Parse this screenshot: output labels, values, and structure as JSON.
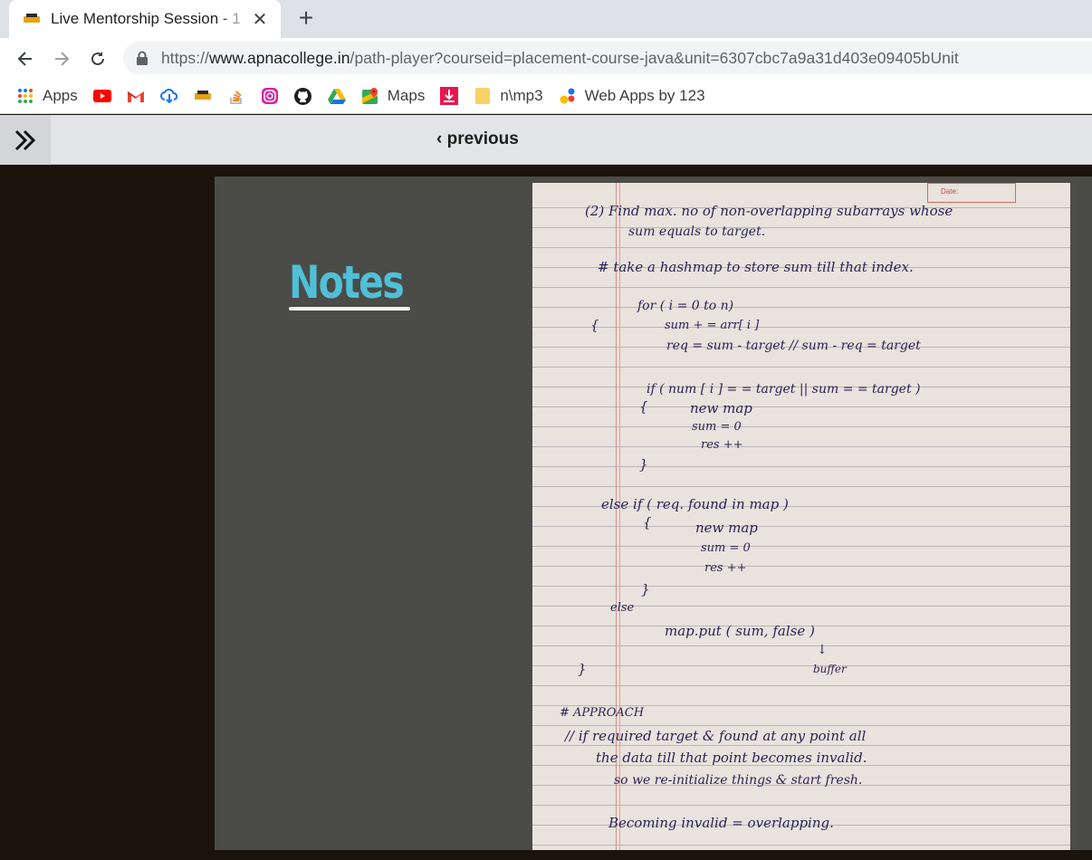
{
  "browser": {
    "tab_title": "Live Mentorship Session - 1",
    "close_glyph": "✕",
    "new_tab_glyph": "+",
    "url_scheme": "https://",
    "url_host": "www.apnacollege.in",
    "url_path": "/path-player?courseid=placement-course-java&unit=6307cbc7a9a31d403e09405bUnit",
    "bookmarks": {
      "apps": "Apps",
      "maps": "Maps",
      "mp3": "n\\mp3",
      "webapps": "Web Apps by 123"
    }
  },
  "player": {
    "previous_label": "‹ previous"
  },
  "slide": {
    "notes_title": "Notes",
    "paper": {
      "date_label": "Date:",
      "lines": {
        "l1": "(2)  Find max. no of non-overlapping subarrays whose",
        "l2": "sum equals to target.",
        "l3": "#  take a hashmap to store sum till that index.",
        "l4": "for ( i = 0    to n)",
        "l5": "{",
        "l6": "sum + =    arr[ i ]",
        "l7": "req =   sum - target   //  sum - req = target",
        "l8": "if ( num [ i ] = = target  || sum = = target )",
        "l9": "{",
        "l10": "new map",
        "l11": "sum = 0",
        "l12": "res ++",
        "l13": "}",
        "l14": "else if  ( req. found in  map )",
        "l15": "{",
        "l16": "new map",
        "l17": "sum = 0",
        "l18": "res ++",
        "l19": "}",
        "l20": "else",
        "l21": "map.put ( sum,  false )",
        "l22": "↓",
        "l23": "buffer",
        "l24": "}",
        "l25": "#  APPROACH",
        "l26": "//  if  required target  &  found at any point all",
        "l27": "the  data   till   that  point   becomes  invalid.",
        "l28": "so    we     re-initialize  things  &  start  fresh.",
        "l29": "Becoming   invalid =  overlapping."
      }
    }
  }
}
